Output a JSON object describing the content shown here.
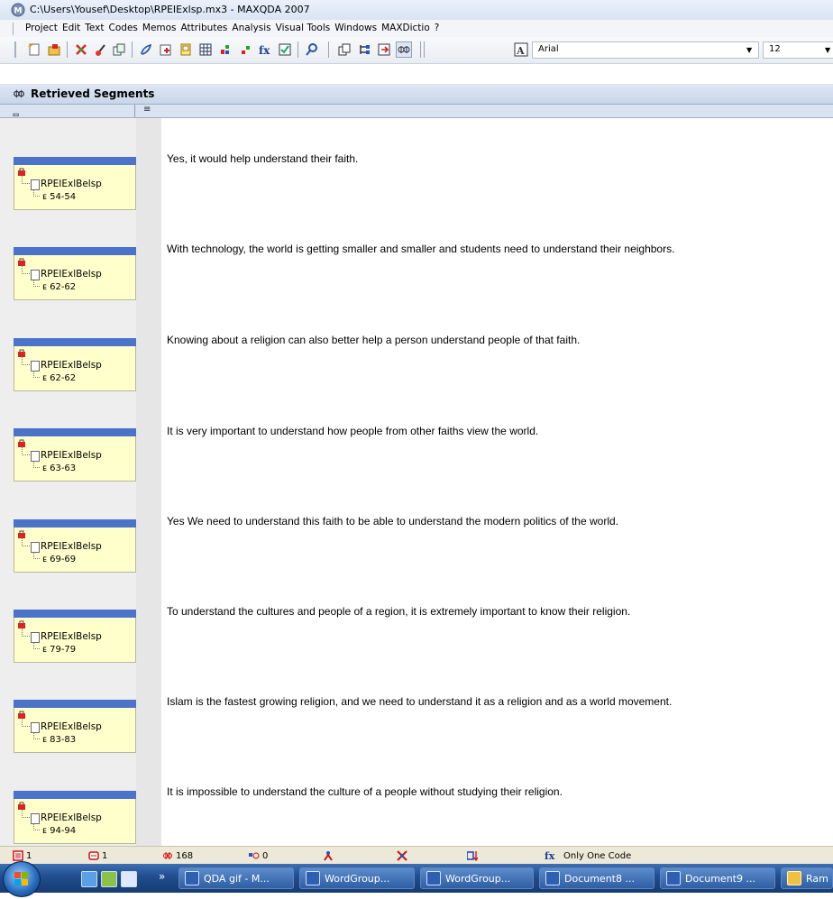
{
  "window": {
    "title": "C:\\Users\\Yousef\\Desktop\\RPEIExlsp.mx3 - MAXQDA 2007"
  },
  "menu": {
    "items": [
      "Project",
      "Edit",
      "Text",
      "Codes",
      "Memos",
      "Attributes",
      "Analysis",
      "Visual Tools",
      "Windows",
      "MAXDictio",
      "?"
    ]
  },
  "toolbar": {
    "font_name": "Arial",
    "font_size": "12",
    "icons": [
      "new-project-icon",
      "open-project-icon",
      "code-system-icon",
      "retrieve-icon",
      "activate-icon",
      "link-icon",
      "document-browser-icon",
      "memo-icon",
      "table-icon",
      "bar-chart-icon",
      "scatter-icon",
      "function-icon",
      "checkbox-icon",
      "search-icon",
      "copy-icon",
      "tree-icon",
      "export-icon",
      "retrieved-segments-icon",
      "font-icon"
    ]
  },
  "panel": {
    "title": "Retrieved Segments",
    "col1_glyph": "ᆷ",
    "col2_glyph": "≡"
  },
  "segments": [
    {
      "doc": "RPEIExlBelsp",
      "pos": "54-54",
      "text": "Yes, it would help understand their faith."
    },
    {
      "doc": "RPEIExlBelsp",
      "pos": "62-62",
      "text": "With technology, the world is getting smaller and smaller and students need to understand their neighbors."
    },
    {
      "doc": "RPEIExlBelsp",
      "pos": "62-62",
      "text": "Knowing about a religion can also better help a person understand people of that faith."
    },
    {
      "doc": "RPEIExlBelsp",
      "pos": "63-63",
      "text": "It is very important to understand how people from other faiths view the world."
    },
    {
      "doc": "RPEIExlBelsp",
      "pos": "69-69",
      "text": "Yes We need to understand this faith to be able to understand the modern politics of the world."
    },
    {
      "doc": "RPEIExlBelsp",
      "pos": "79-79",
      "text": "To understand the cultures and people of a region, it is extremely important to know their religion."
    },
    {
      "doc": "RPEIExlBelsp",
      "pos": "83-83",
      "text": "Islam is the fastest growing religion, and we need to understand it as a religion and as a world movement."
    },
    {
      "doc": "RPEIExlBelsp",
      "pos": "94-94",
      "text": "It is impossible to understand the culture of a people without studying their religion."
    }
  ],
  "status": {
    "documents": "1",
    "text_groups": "1",
    "coded_segments": "168",
    "activated_codes": "0",
    "only_one_code": "Only One Code"
  },
  "taskbar": {
    "tasks": [
      "QDA gif - M...",
      "WordGroup...",
      "WordGroup...",
      "Document8 ...",
      "Document9 ...",
      "Ram"
    ]
  },
  "colors": {
    "segment_bar": "#4a73c9",
    "segment_box": "#ffffcc",
    "taskbar": "#1f4d8e"
  }
}
